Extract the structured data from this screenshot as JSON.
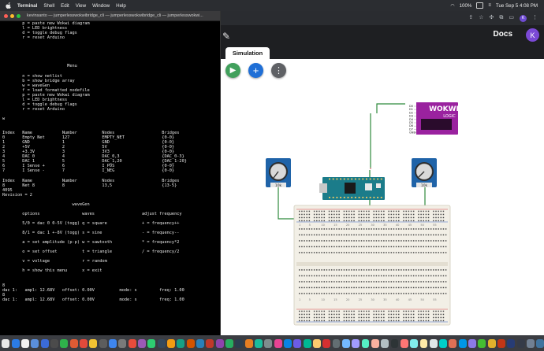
{
  "menubar": {
    "items": [
      "Terminal",
      "Shell",
      "Edit",
      "View",
      "Window",
      "Help"
    ],
    "battery": "100%",
    "clock": "Tue Sep 5  4:08 PM"
  },
  "terminal": {
    "title": "kevinsanto — jumperlesswokwibridge_cli — jumperlesswokwibridge_cli — jumperlesswokwi...",
    "lines": [
      "        p = paste new Wokwi diagram",
      "        l = LED brightness",
      "        d = toggle debug flags",
      "        r = reset Arduino",
      "",
      "",
      "",
      "",
      "",
      "                          Menu",
      "",
      "        n = show netlist",
      "        b = show bridge array",
      "        w = waveGen",
      "        f = load formatted nodefile",
      "        p = paste new Wokwi diagram",
      "        l = LED brightness",
      "        d = toggle debug flags",
      "        r = reset Arduino",
      "",
      "w",
      "",
      "",
      "Index   Name            Number          Nodes                   Bridges",
      "0       Empty Net       127             EMPTY_NET               {0-0}",
      "1       GND             1               GND                     {0-0}",
      "2       +5V             2               5V                      {0-0}",
      "3       +3.3V           3               3V3                     {0-0}",
      "4       DAC 0           4               DAC_0,3                 {DAC_0-3}",
      "5       DAC 1           5               DAC_1,20                {DAC_1-20}",
      "6       I Sense +       6               I_POS                   {0-0}",
      "7       I Sense -       7               I_NEG                   {0-0}",
      "",
      "Index   Name            Number          Nodes                   Bridges",
      "8       Net 8           8               13,5                    {13-5}",
      "4095",
      "Revision = 2",
      "",
      "                            waveGen",
      "",
      "        options                 waves                   adjust frequency",
      "",
      "        5/0 = dac 0 0-5V (togg) q = square              + = frequency++",
      "",
      "        8/1 = dac 1 +-8V (togg) s = sine                - = frequency--",
      "",
      "        a = set amplitude (p-p) w = sawtooth            * = frequency*2",
      "",
      "        o = set offset          t = triangle            / = frequency/2",
      "",
      "        v = voltage             r = random",
      "",
      "        h = show this menu      x = exit",
      "",
      "",
      "8",
      "dac 1:   ampl: 12.68V   offset: 0.00V          mode: s         freq: 1.00",
      "8",
      "dac 1:   ampl: 12.68V   offset: 0.00V          mode: s         freq: 1.00",
      "",
      "",
      "",
      "",
      "",
      "",
      "",
      ""
    ]
  },
  "browser": {
    "docs_label": "Docs",
    "avatar_letter": "K",
    "tab_label": "Simulation",
    "logic_title": "WOKWI",
    "logic_subtitle": "LOGIC",
    "logic_pins": [
      "D0",
      "D1",
      "D2",
      "D3",
      "D4",
      "D5",
      "D6",
      "D7",
      "GND"
    ],
    "pot_label": "10k",
    "breadboard_cols_left": [
      "1",
      "5",
      "10",
      "15",
      "20",
      "25"
    ],
    "breadboard_cols": [
      "30",
      "35",
      "40",
      "45",
      "50",
      "55"
    ]
  },
  "colors": {
    "play": "#41a05c",
    "add": "#1f6fd6",
    "more": "#5f6165",
    "logic": "#9a229f",
    "wire": "#2f8a3c",
    "nano": "#1b7c8a"
  },
  "dock_colors": [
    "#e8e8e8",
    "#2b7be4",
    "#f2f2f2",
    "#5a8fdc",
    "#3b6bd8",
    "#4b4b4b",
    "#2fb24b",
    "#de5b34",
    "#e24a3b",
    "#f1c232",
    "#5d5d5d",
    "#3e86f0",
    "#7a7a7a",
    "#e74c3c",
    "#9b59b6",
    "#2ecc71",
    "#34495e",
    "#f39c12",
    "#16a085",
    "#d35400",
    "#2980b9",
    "#c0392b",
    "#8e44ad",
    "#27ae60",
    "#2c3e50",
    "#e67e22",
    "#1abc9c",
    "#7f8c8d",
    "#e84393",
    "#0984e3",
    "#6c5ce7",
    "#00b894",
    "#fdcb6e",
    "#d63031",
    "#636e72",
    "#74b9ff",
    "#a29bfe",
    "#55efc4",
    "#fab1a0",
    "#b2bec3",
    "#2d3436",
    "#ff7675",
    "#81ecec",
    "#ffeaa7",
    "#dfe6e9",
    "#00cec9",
    "#e17055",
    "#0097e6",
    "#8c7ae6",
    "#44bd32",
    "#e1b12c",
    "#c23616",
    "#273c75",
    "#353b48",
    "#718093",
    "#40739e"
  ]
}
